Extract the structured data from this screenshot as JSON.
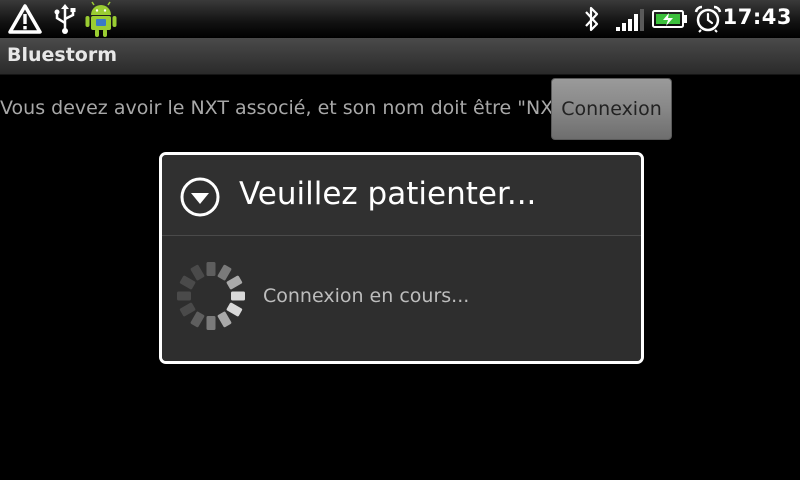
{
  "status_bar": {
    "time": "17:43",
    "icons": [
      "warning-icon",
      "usb-icon",
      "android-icon",
      "bluetooth-icon",
      "signal-icon",
      "battery-icon",
      "alarm-icon"
    ]
  },
  "app": {
    "title": "Bluestorm"
  },
  "main": {
    "instructions": "Vous devez avoir le NXT associé, et son nom doit être \"NXT\"",
    "connect_label": "Connexion"
  },
  "dialog": {
    "title": "Veuillez patienter...",
    "message": "Connexion en cours...",
    "icon": "chevron-down-circle-icon",
    "spinner": "spinner-icon"
  },
  "colors": {
    "background": "#000000",
    "dialog_bg": "#2e2e2e",
    "dialog_border": "#ffffff",
    "button_bg": "#878787",
    "text_muted": "#a8a8a8"
  }
}
